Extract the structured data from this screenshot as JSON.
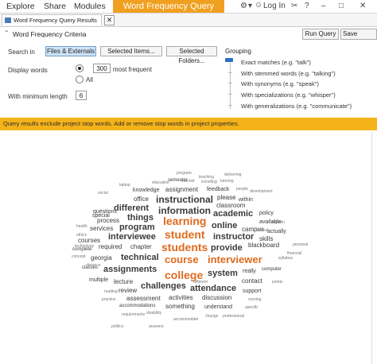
{
  "menubar": {
    "items": [
      "Explore",
      "Share",
      "Modules"
    ],
    "active_tab": "Word Frequency Query",
    "login": "Log In",
    "right_symbols": [
      "⚙",
      "▾",
      "✂",
      "?",
      "–",
      "□",
      "✕"
    ]
  },
  "doc_tab": {
    "label": "Word Frequency Query Results",
    "close": "✕"
  },
  "criteria": {
    "title": "Word Frequency Criteria",
    "run_label": "Run Query",
    "save_label": "Save Criteria",
    "search_in_label": "Search in",
    "search_buttons": [
      "Files & Externals",
      "Selected Items...",
      "Selected Folders..."
    ],
    "display_label": "Display words",
    "display_value": "300",
    "most_frequent": "most frequent",
    "all_label": "All",
    "min_length_label": "With minimum length",
    "min_length_value": "6",
    "grouping_title": "Grouping",
    "grouping_options": [
      "Exact matches (e.g. \"talk\")",
      "With stemmed words (e.g. \"talking\")",
      "With synonyms (e.g. \"speak\")",
      "With specializations (e.g. \"whisper\")",
      "With generalizations (e.g. \"communicate\")"
    ]
  },
  "warning": "Query results exclude project stop words. Add or remove stop words in project properties.",
  "colors": {
    "accent": "#f0a020",
    "warning": "#f5b31a",
    "highlight_word": "#e06a1e",
    "word": "#3a3a3a"
  },
  "cloud_words": [
    {
      "t": "course",
      "s": 13,
      "c": "o"
    },
    {
      "t": "interviewer",
      "s": 13,
      "c": "o"
    },
    {
      "t": "students",
      "s": 14,
      "c": "o"
    },
    {
      "t": "student",
      "s": 14,
      "c": "o"
    },
    {
      "t": "learning",
      "s": 14,
      "c": "o"
    },
    {
      "t": "college",
      "s": 14,
      "c": "o"
    },
    {
      "t": "instructional",
      "s": 12
    },
    {
      "t": "information",
      "s": 12
    },
    {
      "t": "academic",
      "s": 11
    },
    {
      "t": "online",
      "s": 11
    },
    {
      "t": "instructor",
      "s": 11
    },
    {
      "t": "provide",
      "s": 11
    },
    {
      "t": "program",
      "s": 11
    },
    {
      "t": "things",
      "s": 11
    },
    {
      "t": "different",
      "s": 11
    },
    {
      "t": "interviewee",
      "s": 11
    },
    {
      "t": "technical",
      "s": 11
    },
    {
      "t": "assignments",
      "s": 11
    },
    {
      "t": "challenges",
      "s": 11
    },
    {
      "t": "system",
      "s": 11
    },
    {
      "t": "attendance",
      "s": 11
    },
    {
      "t": "classroom",
      "s": 8
    },
    {
      "t": "please",
      "s": 8
    },
    {
      "t": "process",
      "s": 8
    },
    {
      "t": "services",
      "s": 8
    },
    {
      "t": "courses",
      "s": 8
    },
    {
      "t": "required",
      "s": 8
    },
    {
      "t": "chapter",
      "s": 8
    },
    {
      "t": "georgia",
      "s": 8
    },
    {
      "t": "blackboard",
      "s": 8
    },
    {
      "t": "lecture",
      "s": 8
    },
    {
      "t": "review",
      "s": 8
    },
    {
      "t": "assessment",
      "s": 8
    },
    {
      "t": "activities",
      "s": 8
    },
    {
      "t": "discussion",
      "s": 8
    },
    {
      "t": "something",
      "s": 8
    },
    {
      "t": "understand",
      "s": 7
    },
    {
      "t": "accommodations",
      "s": 6
    },
    {
      "t": "multiple",
      "s": 7
    },
    {
      "t": "contact",
      "s": 8
    },
    {
      "t": "support",
      "s": 7
    },
    {
      "t": "really",
      "s": 7
    },
    {
      "t": "computer",
      "s": 6
    },
    {
      "t": "campus",
      "s": 8
    },
    {
      "t": "skills",
      "s": 8
    },
    {
      "t": "actually",
      "s": 7
    },
    {
      "t": "available",
      "s": 7
    },
    {
      "t": "policy",
      "s": 7
    },
    {
      "t": "within",
      "s": 7
    },
    {
      "t": "knowledge",
      "s": 7
    },
    {
      "t": "assignment",
      "s": 8
    },
    {
      "t": "feedback",
      "s": 7
    },
    {
      "t": "office",
      "s": 8
    },
    {
      "t": "questions",
      "s": 7
    },
    {
      "t": "semester",
      "s": 6
    },
    {
      "t": "special",
      "s": 7
    },
    {
      "t": "complete",
      "s": 6
    },
    {
      "t": "classes",
      "s": 6
    },
    {
      "t": "education",
      "s": 5
    },
    {
      "t": "program",
      "s": 5
    },
    {
      "t": "people",
      "s": 5
    },
    {
      "t": "social",
      "s": 5
    },
    {
      "t": "requirements",
      "s": 5
    },
    {
      "t": "disability",
      "s": 5
    },
    {
      "t": "change",
      "s": 5
    },
    {
      "t": "accommodate",
      "s": 5
    },
    {
      "t": "professional",
      "s": 5
    },
    {
      "t": "nursing",
      "s": 5
    },
    {
      "t": "clinical",
      "s": 5
    },
    {
      "t": "ethics",
      "s": 5
    },
    {
      "t": "health",
      "s": 5
    },
    {
      "t": "reading",
      "s": 5
    },
    {
      "t": "points",
      "s": 5
    },
    {
      "t": "syllabus",
      "s": 5
    },
    {
      "t": "practice",
      "s": 5
    },
    {
      "t": "development",
      "s": 5
    },
    {
      "t": "teaching",
      "s": 5
    },
    {
      "t": "concept",
      "s": 5
    },
    {
      "t": "personal",
      "s": 5
    },
    {
      "t": "internet",
      "s": 5
    },
    {
      "t": "including",
      "s": 5
    },
    {
      "t": "specific",
      "s": 5
    },
    {
      "t": "explain",
      "s": 5
    },
    {
      "t": "tutoring",
      "s": 5
    },
    {
      "t": "financial",
      "s": 5
    },
    {
      "t": "delivering",
      "s": 5
    },
    {
      "t": "technology",
      "s": 5
    },
    {
      "t": "laptop",
      "s": 5
    },
    {
      "t": "distance",
      "s": 5
    },
    {
      "t": "politics",
      "s": 5
    },
    {
      "t": "answers",
      "s": 5
    },
    {
      "t": "different",
      "s": 5
    }
  ]
}
